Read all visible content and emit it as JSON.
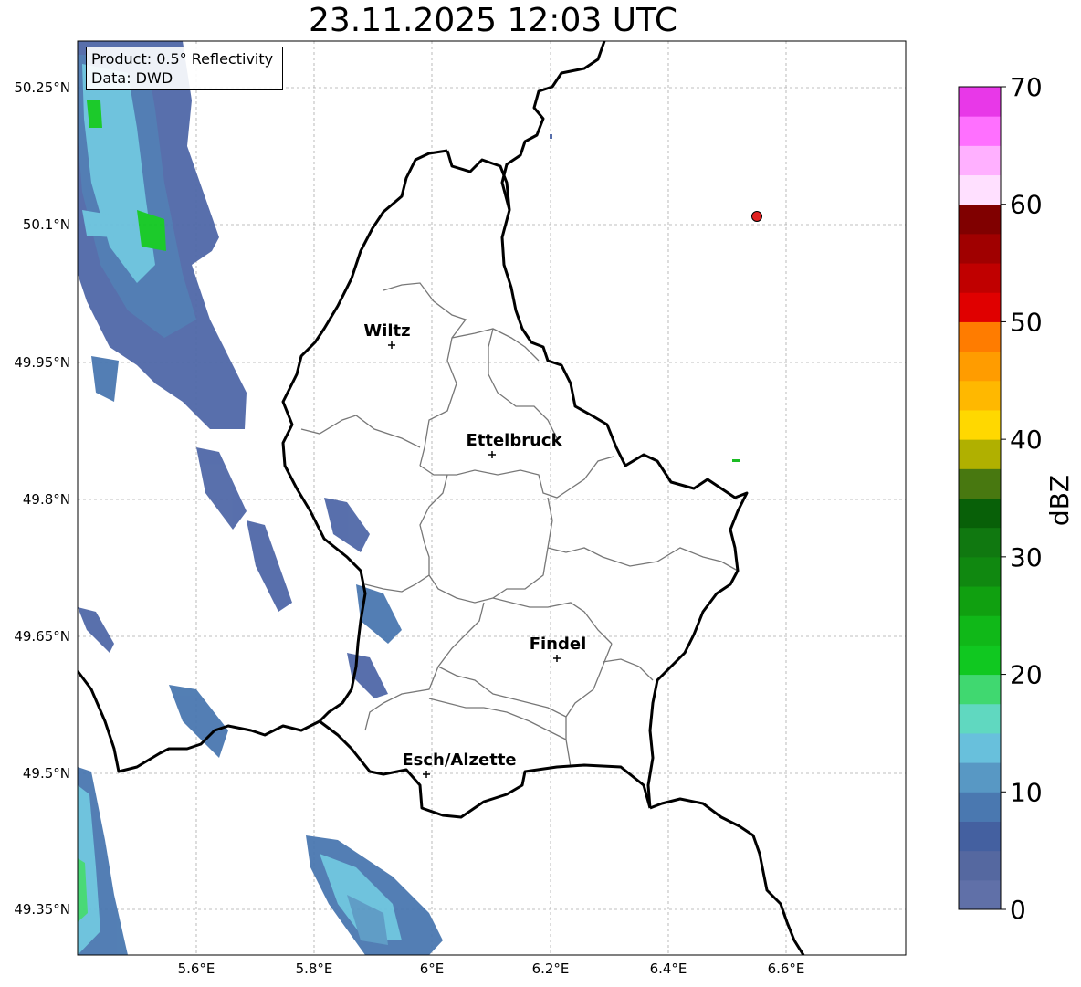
{
  "title": "23.11.2025 12:03 UTC",
  "info": {
    "product": "Product: 0.5° Reflectivity",
    "source": "Data: DWD"
  },
  "axes": {
    "lat_labels": [
      "50.25°N",
      "50.1°N",
      "49.95°N",
      "49.8°N",
      "49.65°N",
      "49.5°N",
      "49.35°N"
    ],
    "lon_labels": [
      "5.6°E",
      "5.8°E",
      "6°E",
      "6.2°E",
      "6.4°E",
      "6.6°E"
    ]
  },
  "cities": [
    {
      "name": "Wiltz"
    },
    {
      "name": "Ettelbruck"
    },
    {
      "name": "Findel"
    },
    {
      "name": "Esch/Alzette"
    }
  ],
  "colorbar": {
    "label": "dBZ",
    "ticks": [
      "0",
      "10",
      "20",
      "30",
      "40",
      "50",
      "60",
      "70"
    ],
    "colors": [
      "#6070a8",
      "#5568a0",
      "#4460a0",
      "#4a78b0",
      "#5898c4",
      "#68c0dc",
      "#60d8c0",
      "#40d870",
      "#10c820",
      "#10b818",
      "#10a010",
      "#108810",
      "#107810",
      "#086008",
      "#487810",
      "#b0b000",
      "#ffd800",
      "#ffb800",
      "#ff9c00",
      "#ff7c00",
      "#e00000",
      "#c00000",
      "#a00000",
      "#800000",
      "#ffe0ff",
      "#ffb0ff",
      "#ff70ff",
      "#e838e8"
    ]
  },
  "station": {
    "color": "#e02020"
  }
}
